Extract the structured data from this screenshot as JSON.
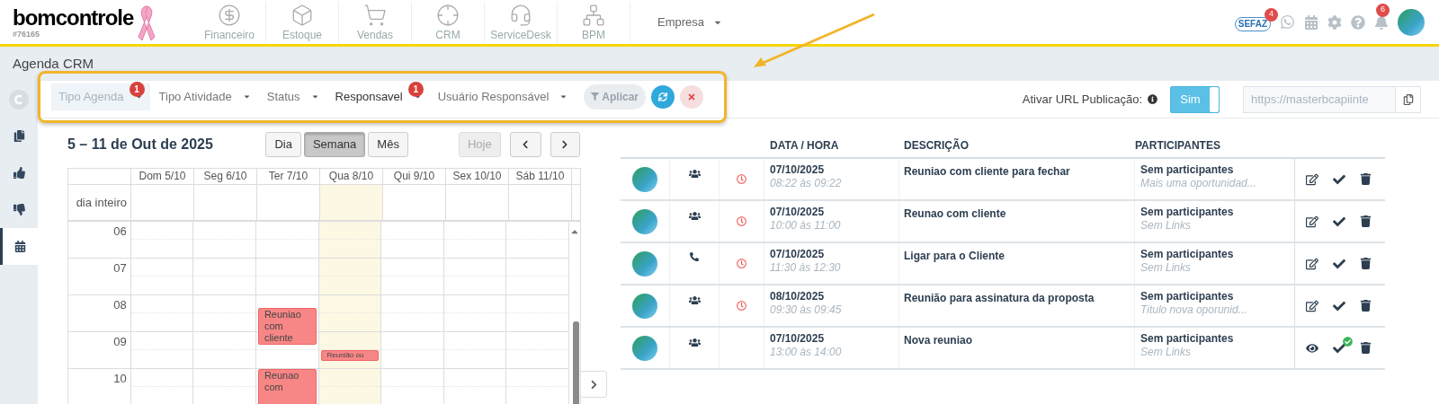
{
  "header": {
    "logo": "bomcontrole",
    "account": "#76165",
    "nav": [
      {
        "label": "Financeiro"
      },
      {
        "label": "Estoque"
      },
      {
        "label": "Vendas"
      },
      {
        "label": "CRM"
      },
      {
        "label": "ServiceDesk"
      },
      {
        "label": "BPM"
      }
    ],
    "company": "Empresa",
    "sefaz": {
      "label": "SEFAZ",
      "count": "4"
    },
    "notifications": "6"
  },
  "page_title": "Agenda CRM",
  "filters": [
    {
      "label": "Tipo Agenda",
      "badge": "1",
      "selected": true
    },
    {
      "label": "Tipo Atividade",
      "selected": false
    },
    {
      "label": "Status",
      "selected": false
    },
    {
      "label": "Responsavel",
      "badge": "1",
      "selected": false
    },
    {
      "label": "Usuário Responsável",
      "selected": false
    }
  ],
  "apply": "Aplicar",
  "publish": {
    "label": "Ativar URL Publicação:",
    "toggle": "Sim",
    "on": true,
    "url": "https://masterbcapiinte"
  },
  "sidebar": [
    {
      "selected": false
    },
    {
      "selected": false
    },
    {
      "selected": false
    },
    {
      "selected": false
    },
    {
      "selected": true
    }
  ],
  "calendar": {
    "range": "5 – 11 de Out de 2025",
    "views": [
      {
        "label": "Dia",
        "selected": false
      },
      {
        "label": "Semana",
        "selected": true
      },
      {
        "label": "Mês",
        "selected": false
      }
    ],
    "today": {
      "label": "Hoje",
      "disabled": true
    },
    "all_day": "dia inteiro",
    "hours": [
      "06",
      "07",
      "08",
      "09",
      "10"
    ],
    "days": [
      {
        "label": "Dom 5/10",
        "today": false
      },
      {
        "label": "Seg 6/10",
        "today": false
      },
      {
        "label": "Ter 7/10",
        "today": false
      },
      {
        "label": "Qua 8/10",
        "today": true
      },
      {
        "label": "Qui 9/10",
        "today": false
      },
      {
        "label": "Sex 10/10",
        "today": false
      },
      {
        "label": "Sáb 11/10",
        "today": false
      }
    ],
    "events": [
      {
        "text": "Reuniao com cliente"
      },
      {
        "text": "Reunião ou"
      },
      {
        "text": "Reunao com"
      }
    ]
  },
  "table": {
    "columns": [
      "DATA / HORA",
      "DESCRIÇÃO",
      "PARTICIPANTES"
    ],
    "rows": [
      {
        "kind": "meeting",
        "alarm": true,
        "date": "07/10/2025",
        "time": "08:22 às 09:22",
        "description": "Reuniao com cliente para fechar",
        "participants": "Sem participantes",
        "note": "Mais uma oportunidad...",
        "completed": false
      },
      {
        "kind": "meeting",
        "alarm": true,
        "date": "07/10/2025",
        "time": "10:00 às 11:00",
        "description": "Reunao com cliente",
        "participants": "Sem participantes",
        "note": "Sem Links",
        "completed": false
      },
      {
        "kind": "call",
        "alarm": true,
        "date": "07/10/2025",
        "time": "11:30 às 12:30",
        "description": "Ligar para o Cliente",
        "participants": "Sem participantes",
        "note": "Sem Links",
        "completed": false
      },
      {
        "kind": "meeting",
        "alarm": true,
        "date": "08/10/2025",
        "time": "09:30 às 09:45",
        "description": "Reunião para assinatura da proposta",
        "participants": "Sem participantes",
        "note": "Titulo nova oporunid...",
        "completed": false
      },
      {
        "kind": "meeting",
        "alarm": false,
        "date": "07/10/2025",
        "time": "13:00 às 14:00",
        "description": "Nova reuniao",
        "participants": "Sem participantes",
        "note": "Sem Links",
        "completed": true
      }
    ]
  }
}
